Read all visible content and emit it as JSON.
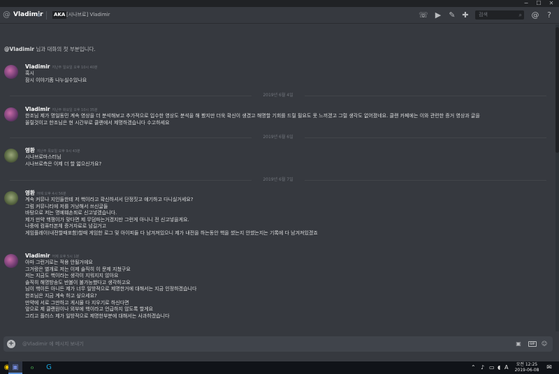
{
  "header": {
    "username": "Vladimir",
    "aka_label": "AKA",
    "nickname": "[시나브로] Vladimir",
    "search_placeholder": "검색"
  },
  "intro": {
    "name": "@Vladimir",
    "text": " 님과 대화의 첫 부분입니다."
  },
  "messages": [
    {
      "author": "Vladimir",
      "time": "지난주 일요일 오후 10시 40분",
      "avatar": "vladimir-avatar",
      "lines": [
        "혹시",
        "잠시 이야기좀 나누실수있나요"
      ]
    },
    {
      "author": "Vladimir",
      "time": "지난주 화요일 오후 10시 35분",
      "avatar": "vladimir-avatar",
      "lines": [
        "한조님 제가 명일동민 계속 영상을 더 분석해보고 추가적으로 입수한 영상도 분석을 해 봤지만 더욱 확신이 생겼고 해명할 기회를 드릴 필요도 못 느끼겠고 그럴 생각도 없어졌네요. 클랜 카페에는 이와 관련한 증거 영상과 글을",
        "올릴것이고 한조님은 현 시간부로 클랜에서 제명하겠습니다 수고하세요"
      ]
    },
    {
      "author": "영환",
      "time": "지난주 목요일 오후 9시 43분",
      "avatar": "younghwan-avatar",
      "lines": [
        "시나브로마스터님",
        "시나브로측은 이제 더 할 얿으신가요?"
      ]
    },
    {
      "author": "영환",
      "time": "어제 오후 4시 56분",
      "avatar": "younghwan-avatar",
      "lines": [
        "계속 커뮤나 지인들한테 저 핵이라고 확신하셔서 단정짓고 얘기하고 다니실거세요?",
        "그럼 커뮤니티에 저를 거낭해서 쓰신글들",
        "바탕으로 저는 명예훼손죄로 신고넣겠습니다.",
        "제가 만약 핵쟁이가 맞다면 제 무덤파는거겠지만 그런게 아니니 전 신고넣을게요.",
        "나중에 컴퓨터본체 증거자료로 넘길거고",
        "게임플레이(내전할때포함)할때 게임한 로그 및 아이피들 다 남겨져있으니 제가 내전을 하는동안 핵을 썼는지 안썼는지는 기록에 다 남겨져있겠죠"
      ]
    },
    {
      "author": "Vladimir",
      "time": "어제 오후 5시 1분",
      "avatar": "vladimir-avatar",
      "lines": [
        "아마 그런거로는 적용 안될거에요",
        "그거랑은 별개로 저는 이제 솔직히 이 문제 지쳤구요",
        "저는 지금도 핵이라는 생각이 지워지지 않아요",
        "솔직히 해명방송도 반볼이 불가능했다고 생각하고요",
        "님이 핵이든 아니든 제가 너무 일방적으로 제명한거에 대해서는 지금 인정하겠습니다",
        "한조님은 지금 계속 하고 싶으세요?",
        "만약에 서로 그만하고 게시물 다 지우기로 하신다면",
        "앞으로 제 클랜원이나 외부에 핵이라고 언급하지 않도록 할게요",
        "그리고 플러스 제가 일방적으로 제명한부분에 대해서는 사과하겠습니다"
      ]
    }
  ],
  "dates": [
    "2019년 6월 4일",
    "2019년 6월 6일",
    "2019년 6월 7일"
  ],
  "composer": {
    "placeholder": "@Vladimir 에 메시지 보내기",
    "gif_label": "GIF"
  },
  "taskbar": {
    "time": "오전 12:25",
    "date": "2019-06-08"
  },
  "colors": {
    "background": "#36393f",
    "header_bg": "#202225",
    "text": "#dcddde",
    "muted": "#72767d"
  }
}
